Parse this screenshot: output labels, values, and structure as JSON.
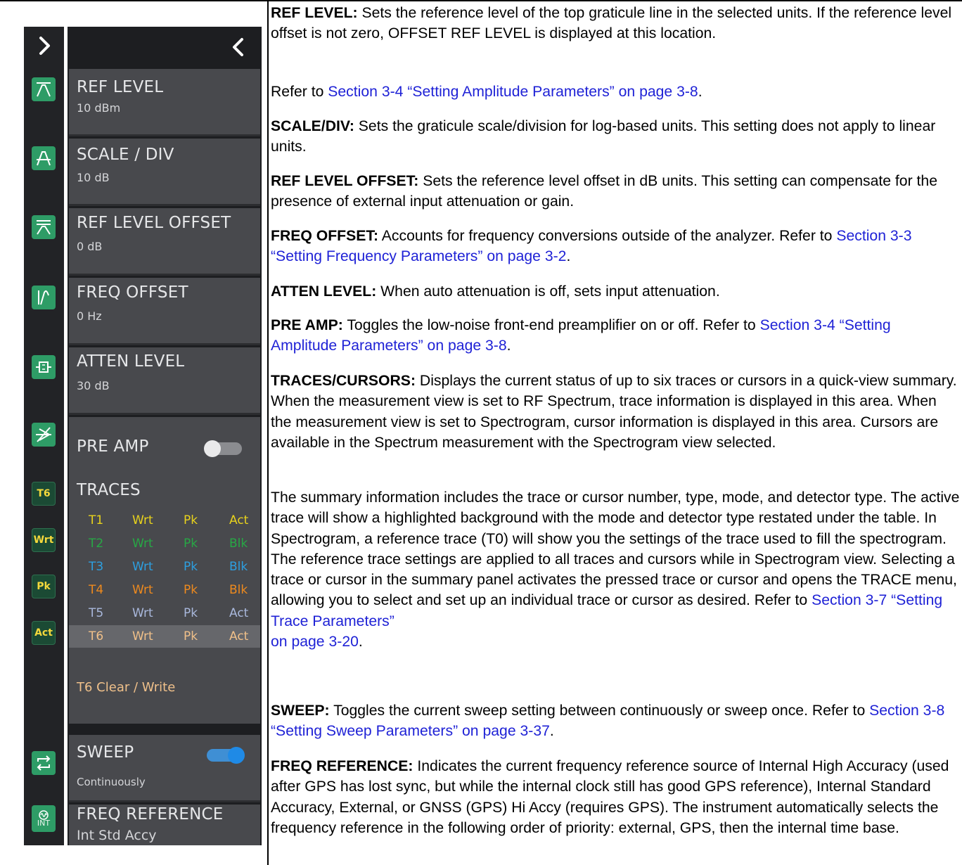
{
  "rail": {
    "items": [
      {
        "icon": "expand-chevron-icon"
      },
      {
        "icon": "ref-level-icon"
      },
      {
        "icon": "scale-div-icon"
      },
      {
        "icon": "ref-offset-icon"
      },
      {
        "icon": "freq-offset-icon"
      },
      {
        "icon": "atten-icon"
      },
      {
        "icon": "preamp-off-icon"
      },
      {
        "label": "T6"
      },
      {
        "label": "Wrt"
      },
      {
        "label": "Pk"
      },
      {
        "label": "Act"
      },
      {
        "icon": "sweep-continuous-icon"
      },
      {
        "label": "INT",
        "icon": "freq-ref-int-icon"
      }
    ]
  },
  "panel": {
    "cards": [
      {
        "title": "REF LEVEL",
        "value": "10 dBm"
      },
      {
        "title": "SCALE / DIV",
        "value": "10 dB"
      },
      {
        "title": "REF LEVEL OFFSET",
        "value": "0 dB"
      },
      {
        "title": "FREQ OFFSET",
        "value": "0 Hz"
      },
      {
        "title": "ATTEN LEVEL",
        "value": "30 dB"
      }
    ],
    "pre_amp": {
      "title": "PRE AMP",
      "state": "off"
    },
    "traces": {
      "title": "TRACES",
      "rows": [
        {
          "id": "T1",
          "type": "Wrt",
          "mode": "Pk",
          "detector": "Act",
          "color": "#e8d21c"
        },
        {
          "id": "T2",
          "type": "Wrt",
          "mode": "Pk",
          "detector": "Blk",
          "color": "#27a845"
        },
        {
          "id": "T3",
          "type": "Wrt",
          "mode": "Pk",
          "detector": "Blk",
          "color": "#2d9fe0"
        },
        {
          "id": "T4",
          "type": "Wrt",
          "mode": "Pk",
          "detector": "Blk",
          "color": "#ee8a1e"
        },
        {
          "id": "T5",
          "type": "Wrt",
          "mode": "Pk",
          "detector": "Act",
          "color": "#a9b8dc"
        },
        {
          "id": "T6",
          "type": "Wrt",
          "mode": "Pk",
          "detector": "Act",
          "color": "#f0c089"
        }
      ],
      "active_summary": "T6 Clear / Write"
    },
    "sweep": {
      "title": "SWEEP",
      "value": "Continuously",
      "state": "on"
    },
    "freq_reference": {
      "title": "FREQ REFERENCE",
      "value": "Int Std Accy"
    }
  },
  "doc": {
    "p1_term": "REF LEVEL:",
    "p1_text": " Sets the reference level of the top graticule line in the selected units. If the reference level offset is not zero, OFFSET REF LEVEL is displayed at this location.",
    "p2_pre": "Refer to ",
    "p2_link": "Section 3-4 “Setting Amplitude Parameters” on page 3-8",
    "p2_post": ".",
    "p3_term": "SCALE/DIV:",
    "p3_text": " Sets the graticule scale/division for log-based units. This setting does not apply to linear units.",
    "p4_term": "REF LEVEL OFFSET:",
    "p4_text": " Sets the reference level offset in dB units. This setting can compensate for the presence of external input attenuation or gain.",
    "p5_term": "FREQ OFFSET:",
    "p5_text": " Accounts for frequency conversions outside of the analyzer. Refer to ",
    "p5_link": "Section 3-3 “Setting Frequency Parameters” on page 3-2",
    "p5_post": ".",
    "p6_term": "ATTEN LEVEL:",
    "p6_text": " When auto attenuation is off, sets input attenuation.",
    "p7_term": "PRE AMP:",
    "p7_text": " Toggles the low-noise front-end preamplifier on or off. Refer to ",
    "p7_link": "Section 3-4 “Setting Amplitude Parameters” on page 3-8",
    "p7_post": ".",
    "p8_term": "TRACES/CURSORS:",
    "p8_text": " Displays the current status of up to six traces or cursors in a quick-view summary. When the measurement view is set to RF Spectrum, trace information is displayed in this area. When the measurement view is set to Spectrogram, cursor information is displayed in this area. Cursors are available in the Spectrum measurement with the Spectrogram view selected.",
    "p9_text": "The summary information includes the trace or cursor number, type, mode, and detector type. The active trace will show a highlighted background with the mode and detector type restated under the table. In Spectrogram, a reference trace (T0) will show you the settings of the trace used to fill the spectrogram. The reference trace settings are applied to all traces and cursors while in Spectrogram view. Selecting a trace or cursor in the summary panel activates the pressed trace or cursor and opens the TRACE menu, allowing you to select and set up an individual trace or cursor as desired. Refer to ",
    "p9_link1": "Section 3-7 “Setting Trace Parameters”",
    "p9_link2": "on page 3-20",
    "p9_post": ".",
    "p10_term": "SWEEP:",
    "p10_text": " Toggles the current sweep setting between continuously or sweep once. Refer to ",
    "p10_link": "Section 3-8 “Setting Sweep Parameters” on page 3-37",
    "p10_post": ".",
    "p11_term": "FREQ REFERENCE:",
    "p11_text": " Indicates the current frequency reference source of Internal High Accuracy (used after GPS has lost sync, but while the internal clock still has good GPS reference), Internal Standard Accuracy, External, or GNSS (GPS) Hi Accy (requires GPS). The instrument automatically selects the frequency reference in the following order of priority: external, GPS, then the internal time base."
  }
}
